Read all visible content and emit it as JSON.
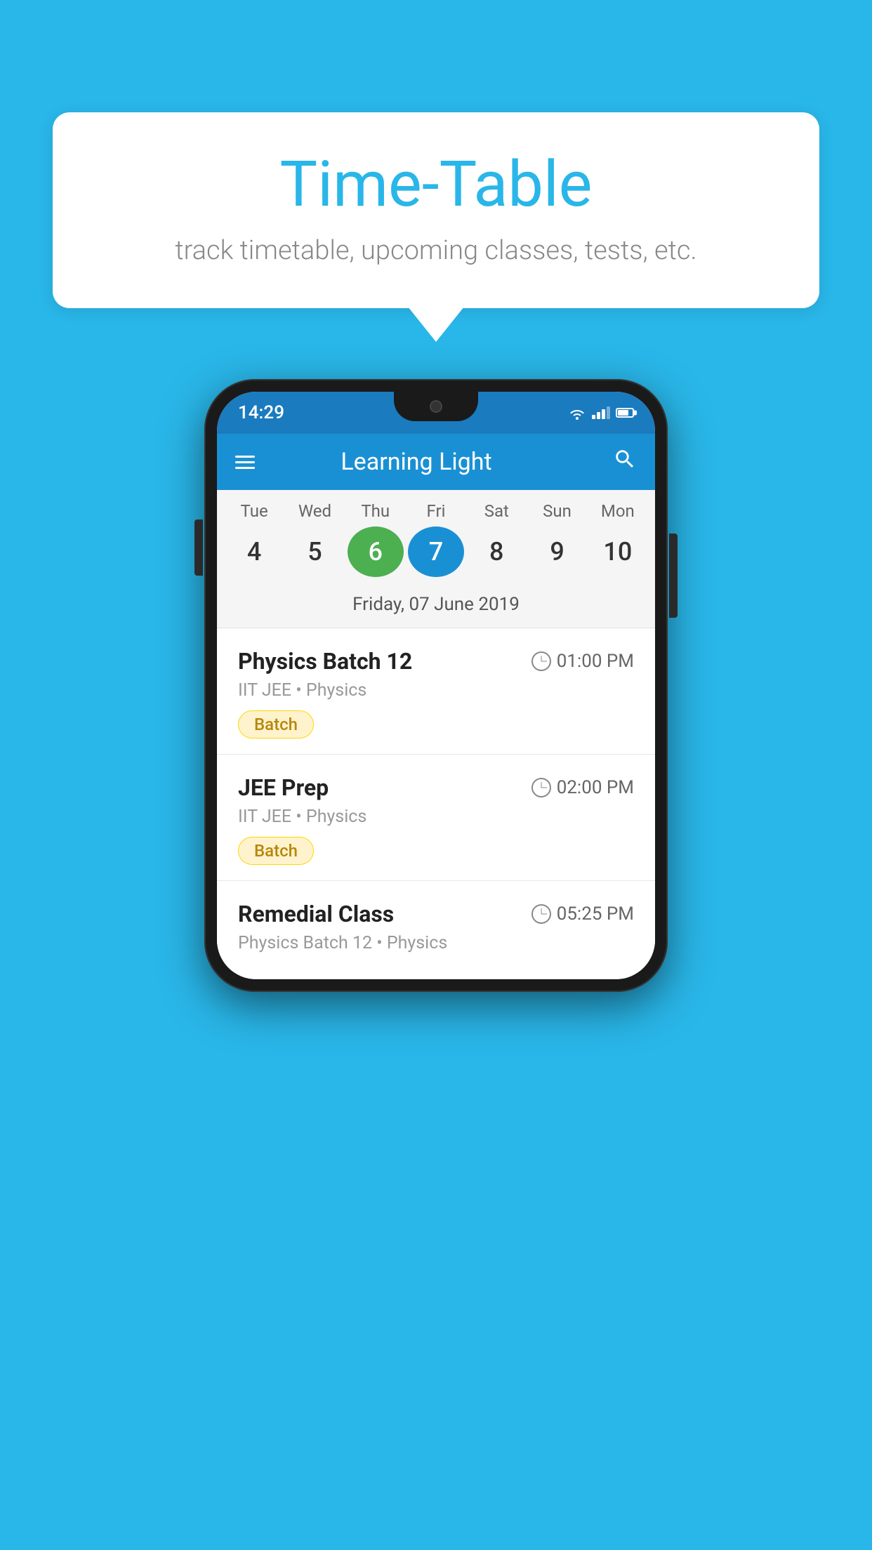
{
  "background_color": "#29b6e8",
  "speech_bubble": {
    "title": "Time-Table",
    "subtitle": "track timetable, upcoming classes, tests, etc."
  },
  "phone": {
    "status_bar": {
      "time": "14:29"
    },
    "app_bar": {
      "title": "Learning Light"
    },
    "calendar": {
      "days": [
        {
          "label": "Tue",
          "num": "4"
        },
        {
          "label": "Wed",
          "num": "5"
        },
        {
          "label": "Thu",
          "num": "6",
          "state": "today"
        },
        {
          "label": "Fri",
          "num": "7",
          "state": "selected"
        },
        {
          "label": "Sat",
          "num": "8"
        },
        {
          "label": "Sun",
          "num": "9"
        },
        {
          "label": "Mon",
          "num": "10"
        }
      ],
      "selected_date": "Friday, 07 June 2019"
    },
    "schedule": [
      {
        "title": "Physics Batch 12",
        "time": "01:00 PM",
        "sub": "IIT JEE • Physics",
        "tag": "Batch"
      },
      {
        "title": "JEE Prep",
        "time": "02:00 PM",
        "sub": "IIT JEE • Physics",
        "tag": "Batch"
      },
      {
        "title": "Remedial Class",
        "time": "05:25 PM",
        "sub": "Physics Batch 12 • Physics",
        "tag": ""
      }
    ]
  }
}
